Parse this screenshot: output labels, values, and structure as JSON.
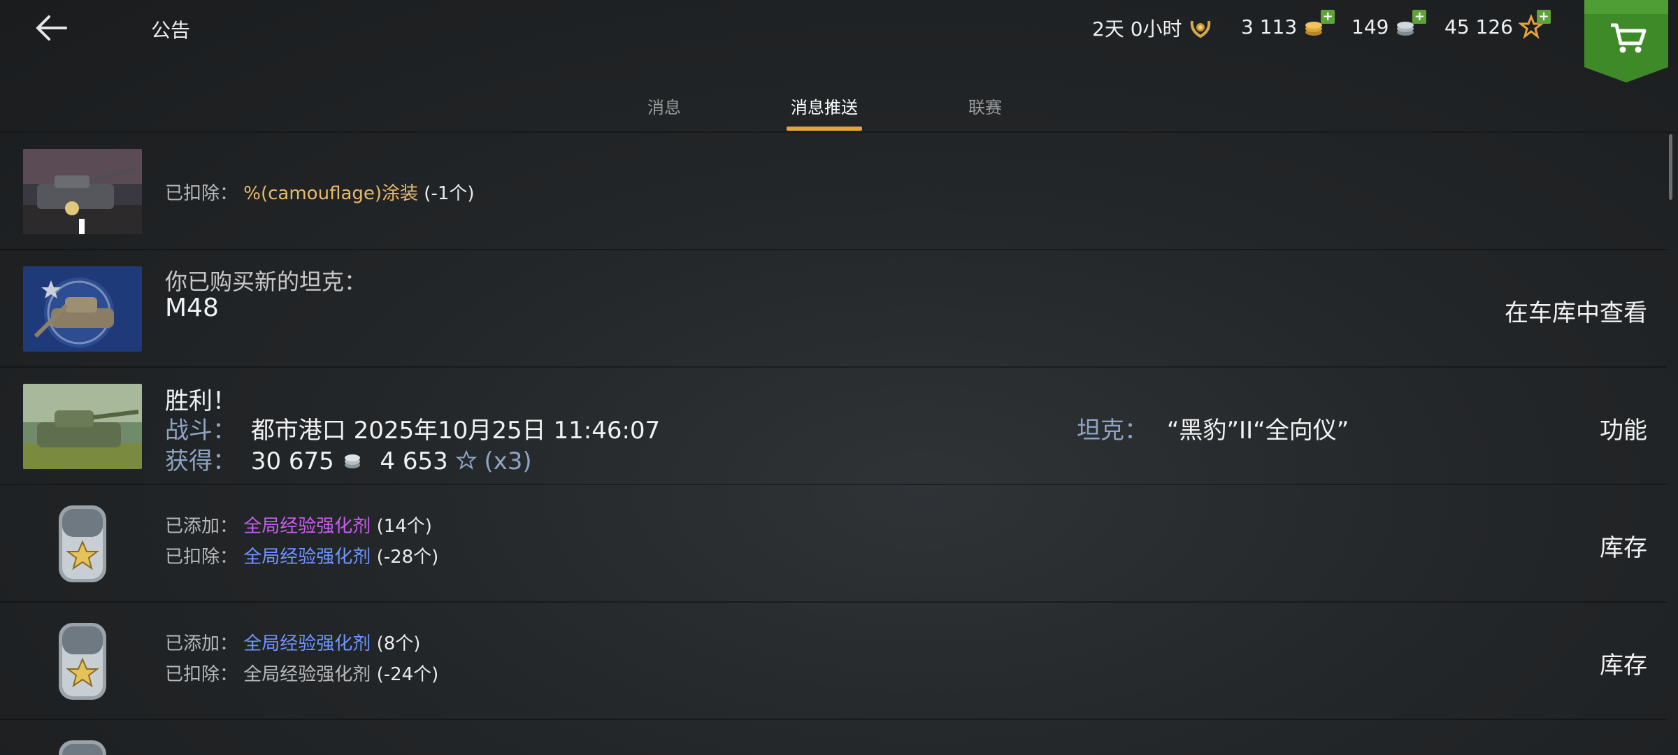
{
  "header": {
    "title": "公告",
    "premium_time": "2天 0小时",
    "gold": "3 113",
    "silver": "149",
    "free_xp": "45 126"
  },
  "tabs": [
    {
      "label": "消息"
    },
    {
      "label": "消息推送"
    },
    {
      "label": "联赛"
    }
  ],
  "messages": [
    {
      "prefix": "已扣除：",
      "item": "%(camouflage)涂装",
      "suffix": "(-1个)"
    },
    {
      "line1": "你已购买新的坦克：",
      "line2": "M48",
      "action": "在车库中查看"
    },
    {
      "title": "胜利！",
      "battle_label": "战斗：",
      "battle_value": "都市港口 2025年10月25日 11:46:07",
      "earn_label": "获得：",
      "credits": "30 675",
      "xp": "4 653",
      "multiplier": "(x3)",
      "tank_label": "坦克：",
      "tank_value": "“黑豹”II“全向仪”",
      "action": "功能"
    },
    {
      "add_prefix": "已添加：",
      "add_item": "全局经验强化剂",
      "add_count": "(14个)",
      "sub_prefix": "已扣除：",
      "sub_item": "全局经验强化剂",
      "sub_count": "(-28个)",
      "action": "库存"
    },
    {
      "add_prefix": "已添加：",
      "add_item": "全局经验强化剂",
      "add_count": "(8个)",
      "sub_prefix": "已扣除：",
      "sub_item": "全局经验强化剂",
      "sub_count": "(-24个)",
      "action": "库存"
    }
  ],
  "colors": {
    "accent": "#e9a23a",
    "gold_text": "#e9b968",
    "purple_text": "#c85cf0",
    "blue_text": "#6f95ff",
    "cart_green": "#3f8a28"
  }
}
